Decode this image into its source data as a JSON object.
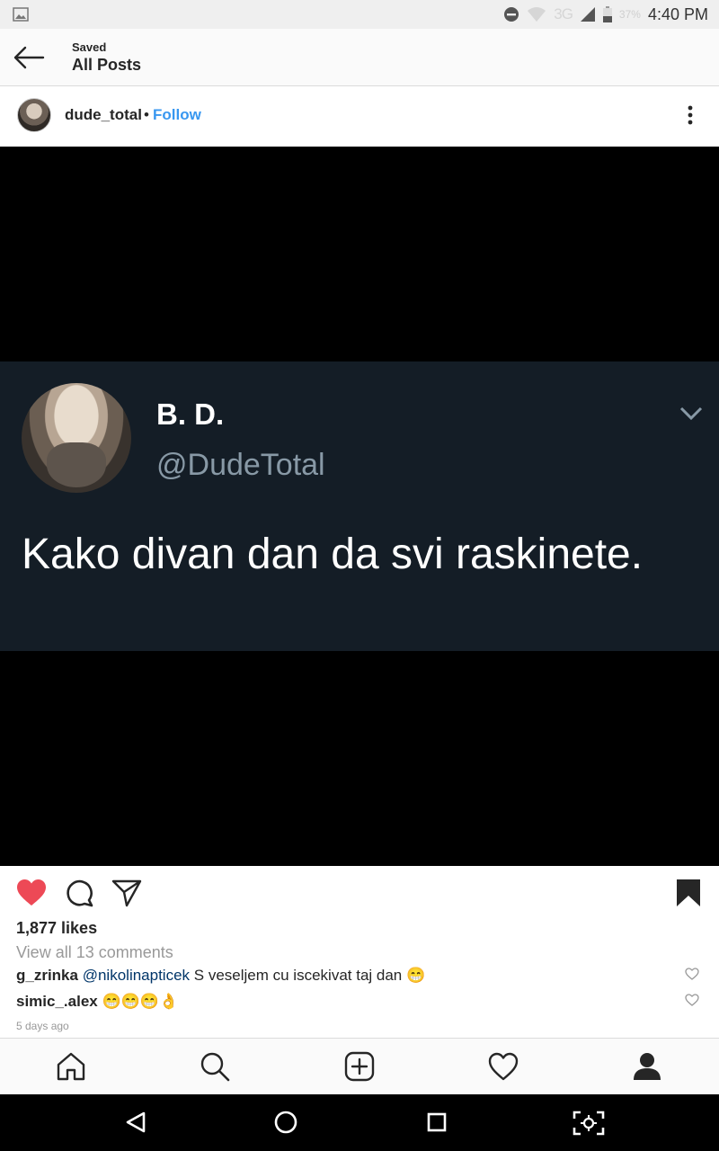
{
  "status_bar": {
    "network": "3G",
    "battery": "37%",
    "time": "4:40 PM"
  },
  "header": {
    "subtitle": "Saved",
    "title": "All Posts"
  },
  "post": {
    "username": "dude_total",
    "separator": "•",
    "follow_label": "Follow",
    "image": {
      "tweet_name": "B. D.",
      "tweet_handle": "@DudeTotal",
      "tweet_text": "Kako divan dan da svi raskinete."
    },
    "likes": "1,877 likes",
    "view_comments": "View all 13 comments",
    "comments": [
      {
        "user": "g_zrinka",
        "mention": "@nikolinapticek",
        "text": " S veseljem cu iscekivat taj dan 😁"
      },
      {
        "user": "simic_.alex",
        "mention": "",
        "text": " 😁😁😁👌"
      }
    ],
    "time_ago": "5 days ago"
  },
  "icons": {
    "back": "arrow-left-icon",
    "more": "more-vertical-icon",
    "like": "heart-filled-icon",
    "comment": "comment-bubble-icon",
    "share": "send-icon",
    "save": "bookmark-filled-icon",
    "tabs": [
      "home-icon",
      "search-icon",
      "add-post-icon",
      "activity-heart-icon",
      "profile-icon"
    ]
  },
  "colors": {
    "like_red": "#ed4956",
    "follow_blue": "#3897f0",
    "tweet_bg": "#141d26",
    "tweet_handle": "#8899a6"
  }
}
